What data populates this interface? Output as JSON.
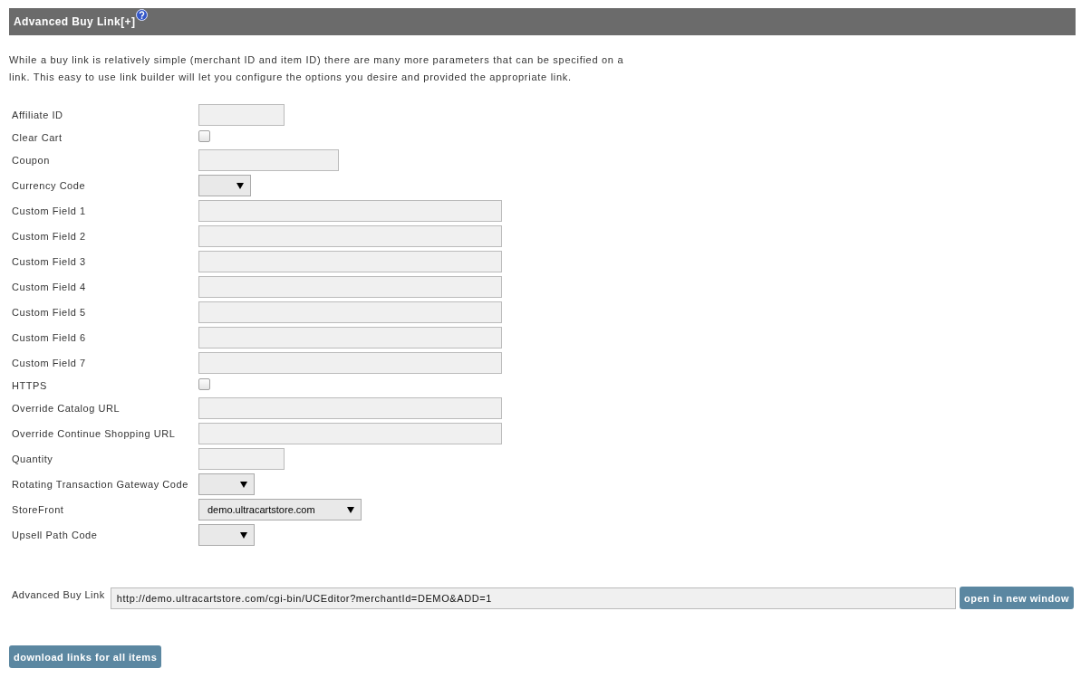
{
  "panel": {
    "title": "Advanced Buy Link",
    "toggle": "[+]"
  },
  "description": "While a buy link is relatively simple (merchant ID and item ID) there are many more parameters that can be specified on a link. This easy to use link builder will let you configure the options you desire and provided the appropriate link.",
  "form": {
    "fields": [
      {
        "label": "Affiliate ID",
        "kind": "text"
      },
      {
        "label": "Clear Cart",
        "kind": "checkbox",
        "checked": false
      },
      {
        "label": "Coupon",
        "kind": "text"
      },
      {
        "label": "Currency Code",
        "kind": "select"
      },
      {
        "label": "Custom Field 1",
        "kind": "text"
      },
      {
        "label": "Custom Field 2",
        "kind": "text"
      },
      {
        "label": "Custom Field 3",
        "kind": "text"
      },
      {
        "label": "Custom Field 4",
        "kind": "text"
      },
      {
        "label": "Custom Field 5",
        "kind": "text"
      },
      {
        "label": "Custom Field 6",
        "kind": "text"
      },
      {
        "label": "Custom Field 7",
        "kind": "text"
      },
      {
        "label": "HTTPS",
        "kind": "checkbox",
        "checked": false
      },
      {
        "label": "Override Catalog URL",
        "kind": "text"
      },
      {
        "label": "Override Continue Shopping URL",
        "kind": "text"
      },
      {
        "label": "Quantity",
        "kind": "text"
      },
      {
        "label": "Rotating Transaction Gateway Code",
        "kind": "select"
      },
      {
        "label": "StoreFront",
        "kind": "select",
        "value": "demo.ultracartstore.com"
      },
      {
        "label": "Upsell Path Code",
        "kind": "select"
      }
    ]
  },
  "result": {
    "label": "Advanced Buy Link",
    "value": "http://demo.ultracartstore.com/cgi-bin/UCEditor?merchantId=DEMO&ADD=1",
    "button": "open in new window"
  },
  "download_button": "download links for all items"
}
